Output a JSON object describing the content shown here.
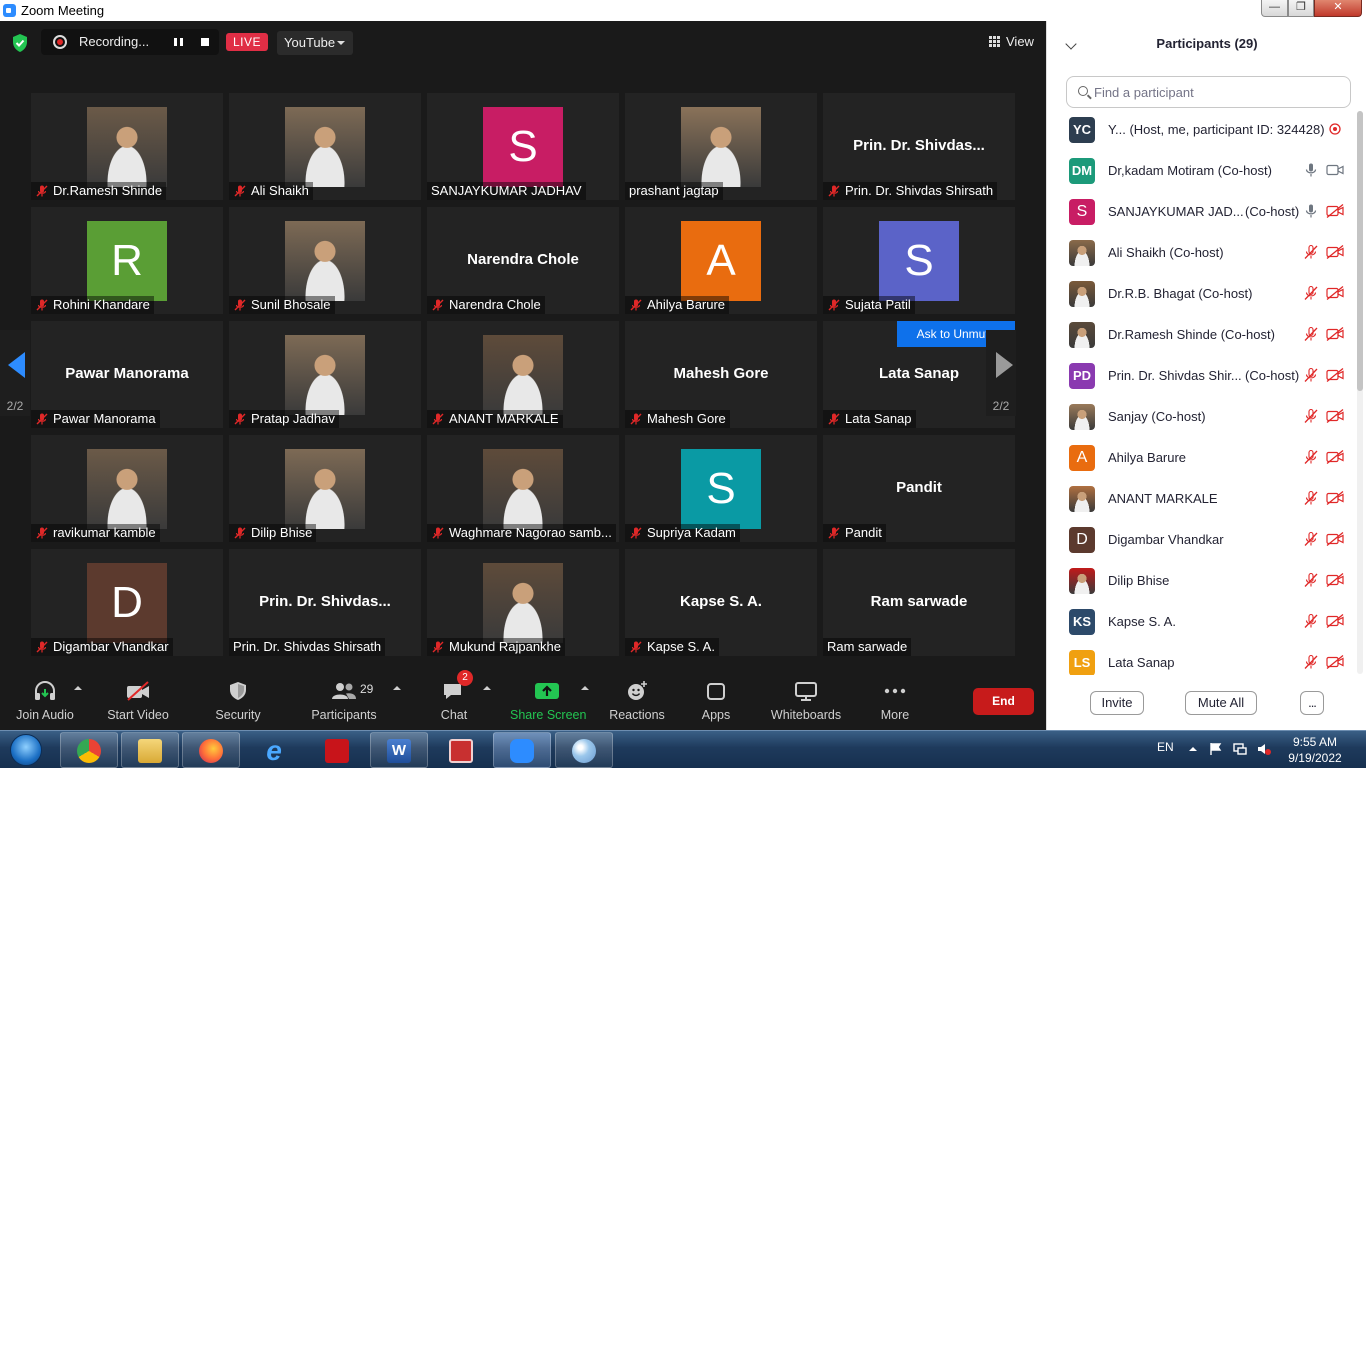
{
  "window": {
    "title": "Zoom Meeting"
  },
  "topbar": {
    "recording_label": "Recording...",
    "live_label": "LIVE",
    "stream_target": "YouTube",
    "view_label": "View"
  },
  "gallery": {
    "page_indicator": "2/2",
    "tiles": [
      {
        "name": "Dr.Ramesh Shinde",
        "display": "photo",
        "muted": true
      },
      {
        "name": "Ali Shaikh",
        "display": "photo",
        "muted": true
      },
      {
        "name": "SANJAYKUMAR JADHAV",
        "display": "letter",
        "letter": "S",
        "color": "#c81d64",
        "muted": false
      },
      {
        "name": "prashant jagtap",
        "display": "photo",
        "muted": false
      },
      {
        "name": "Prin. Dr. Shivdas Shirsath",
        "display": "text",
        "big": "Prin. Dr. Shivdas...",
        "muted": true
      },
      {
        "name": "Rohini Khandare",
        "display": "letter",
        "letter": "R",
        "color": "#5a9e35",
        "muted": true
      },
      {
        "name": "Sunil Bhosale",
        "display": "photo",
        "muted": true
      },
      {
        "name": "Narendra Chole",
        "display": "text",
        "big": "Narendra Chole",
        "muted": true
      },
      {
        "name": "Ahilya Barure",
        "display": "letter",
        "letter": "A",
        "color": "#e96c0f",
        "muted": true
      },
      {
        "name": "Sujata Patil",
        "display": "letter",
        "letter": "S",
        "color": "#5b63c8",
        "muted": true
      },
      {
        "name": "Pawar Manorama",
        "display": "text",
        "big": "Pawar Manorama",
        "muted": true
      },
      {
        "name": "Pratap Jadhav",
        "display": "photo",
        "muted": true
      },
      {
        "name": "ANANT MARKALE",
        "display": "photo",
        "muted": true
      },
      {
        "name": "Mahesh Gore",
        "display": "text",
        "big": "Mahesh Gore",
        "muted": true
      },
      {
        "name": "Lata Sanap",
        "display": "text",
        "big": "Lata Sanap",
        "muted": true,
        "ask_unmute": "Ask to Unmute"
      },
      {
        "name": "ravikumar kamble",
        "display": "photo",
        "muted": true
      },
      {
        "name": "Dilip Bhise",
        "display": "photo",
        "muted": true
      },
      {
        "name": "Waghmare Nagorao samb...",
        "display": "photo",
        "muted": true
      },
      {
        "name": "Supriya Kadam",
        "display": "letter",
        "letter": "S",
        "color": "#0a9aa4",
        "muted": true
      },
      {
        "name": "Pandit",
        "display": "text",
        "big": "Pandit",
        "muted": true
      },
      {
        "name": "Digambar Vhandkar",
        "display": "letter",
        "letter": "D",
        "color": "#5c3a2e",
        "muted": true
      },
      {
        "name": "Prin. Dr. Shivdas Shirsath",
        "display": "text",
        "big": "Prin. Dr. Shivdas...",
        "muted": false
      },
      {
        "name": "Mukund Rajpankhe",
        "display": "photo",
        "muted": true
      },
      {
        "name": "Kapse S. A.",
        "display": "text",
        "big": "Kapse S. A.",
        "muted": true
      },
      {
        "name": "Ram sarwade",
        "display": "text",
        "big": "Ram sarwade",
        "muted": false
      }
    ]
  },
  "toolbar": {
    "join_audio": "Join Audio",
    "start_video": "Start Video",
    "security": "Security",
    "participants": "Participants",
    "participants_count": "29",
    "chat": "Chat",
    "chat_badge": "2",
    "share_screen": "Share Screen",
    "reactions": "Reactions",
    "apps": "Apps",
    "whiteboards": "Whiteboards",
    "more": "More",
    "end": "End"
  },
  "panel": {
    "title": "Participants (29)",
    "search_placeholder": "Find a participant",
    "participants": [
      {
        "name": "Y... (Host, me, participant ID: 324428)",
        "role": "",
        "avatar": "YC",
        "color": "#2d3e50",
        "mic": "recording",
        "cam": "none"
      },
      {
        "name": "Dr,kadam Motiram (Co-host)",
        "role": "",
        "avatar": "DM",
        "color": "#1c9a7a",
        "mic": "on",
        "cam": "on"
      },
      {
        "name": "SANJAYKUMAR JAD...",
        "role": "(Co-host)",
        "avatar": "S",
        "color": "#c81d64",
        "mic": "on",
        "cam": "off"
      },
      {
        "name": "Ali Shaikh (Co-host)",
        "role": "",
        "avatar": "photo",
        "color": "#8a6a4a",
        "mic": "muted",
        "cam": "off"
      },
      {
        "name": "Dr.R.B. Bhagat (Co-host)",
        "role": "",
        "avatar": "photo",
        "color": "#7a5a3a",
        "mic": "muted",
        "cam": "off"
      },
      {
        "name": "Dr.Ramesh Shinde (Co-host)",
        "role": "",
        "avatar": "photo",
        "color": "#5a4a3a",
        "mic": "muted",
        "cam": "off"
      },
      {
        "name": "Prin. Dr. Shivdas Shir...",
        "role": "(Co-host)",
        "avatar": "PD",
        "color": "#8a3ab0",
        "mic": "muted",
        "cam": "off"
      },
      {
        "name": "Sanjay (Co-host)",
        "role": "",
        "avatar": "photo",
        "color": "#9a7a5a",
        "mic": "muted",
        "cam": "off"
      },
      {
        "name": "Ahilya Barure",
        "role": "",
        "avatar": "A",
        "color": "#e96c0f",
        "mic": "muted",
        "cam": "off"
      },
      {
        "name": "ANANT MARKALE",
        "role": "",
        "avatar": "photo",
        "color": "#b07040",
        "mic": "muted",
        "cam": "off"
      },
      {
        "name": "Digambar Vhandkar",
        "role": "",
        "avatar": "D",
        "color": "#5c3a2e",
        "mic": "muted",
        "cam": "off"
      },
      {
        "name": "Dilip Bhise",
        "role": "",
        "avatar": "photo",
        "color": "#c21a1a",
        "mic": "muted",
        "cam": "off"
      },
      {
        "name": "Kapse S. A.",
        "role": "",
        "avatar": "KS",
        "color": "#2d4a6a",
        "mic": "muted",
        "cam": "off"
      },
      {
        "name": "Lata Sanap",
        "role": "",
        "avatar": "LS",
        "color": "#f0a010",
        "mic": "muted",
        "cam": "off"
      }
    ],
    "invite": "Invite",
    "mute_all": "Mute All",
    "more": "..."
  },
  "taskbar": {
    "language": "EN",
    "time": "9:55 AM",
    "date": "9/19/2022"
  }
}
